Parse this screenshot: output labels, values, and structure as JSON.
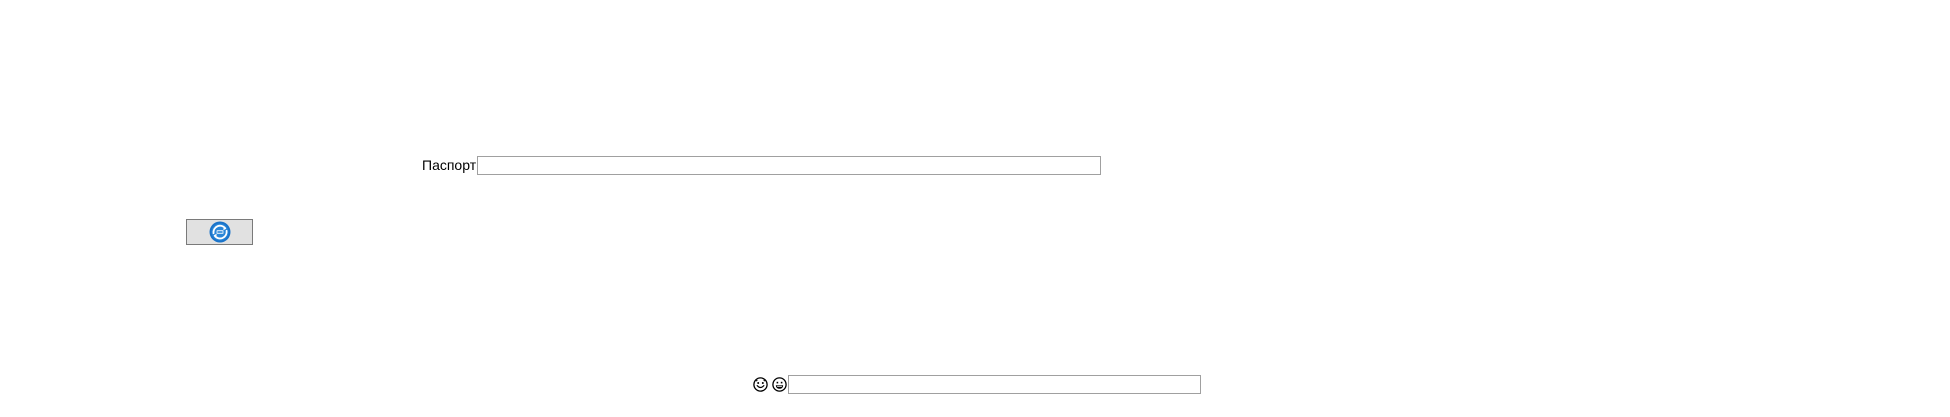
{
  "form": {
    "passport_label": "Паспорт",
    "passport_value": ""
  },
  "toolbar": {
    "refresh_icon": "refresh-icon",
    "refresh_icon_color": "#1a73c9"
  },
  "chat": {
    "emoji_icons": [
      "smiley-outline-icon",
      "grinning-face-icon"
    ],
    "message_value": ""
  }
}
